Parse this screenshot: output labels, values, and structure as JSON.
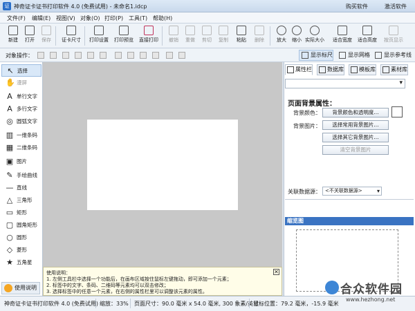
{
  "window": {
    "title": "神奇证卡证书打印软件 4.0 (免费试用) - 未命名1.idcp",
    "buy": "购买软件",
    "activate": "激活软件"
  },
  "menu": [
    "文件(F)",
    "编辑(E)",
    "视图(V)",
    "对象(O)",
    "打印(P)",
    "工具(T)",
    "帮助(H)"
  ],
  "toolbar": [
    {
      "label": "新建",
      "enabled": true
    },
    {
      "label": "打开",
      "enabled": true
    },
    {
      "label": "保存",
      "enabled": false
    },
    {
      "label": "证卡尺寸",
      "enabled": true
    },
    {
      "label": "打印设置",
      "enabled": true
    },
    {
      "label": "打印预览",
      "enabled": true
    },
    {
      "label": "直接打印",
      "enabled": true
    },
    {
      "label": "撤销",
      "enabled": false
    },
    {
      "label": "重做",
      "enabled": false
    },
    {
      "label": "剪切",
      "enabled": false
    },
    {
      "label": "复制",
      "enabled": false
    },
    {
      "label": "粘贴",
      "enabled": true
    },
    {
      "label": "删除",
      "enabled": false
    },
    {
      "label": "放大",
      "enabled": true
    },
    {
      "label": "缩小",
      "enabled": true
    },
    {
      "label": "实际大小",
      "enabled": true
    },
    {
      "label": "适合宽度",
      "enabled": true
    },
    {
      "label": "适合高度",
      "enabled": true
    },
    {
      "label": "按页显示",
      "enabled": false
    }
  ],
  "toolbar2": {
    "label": "对象操作：",
    "show_ruler": "显示标尺",
    "show_grid": "显示网格",
    "show_guides": "显示参考线"
  },
  "tools": [
    "选择",
    "漫屏",
    "单行文字",
    "多行文字",
    "圆弧文字",
    "一维条码",
    "二维条码",
    "图片",
    "手绘曲线",
    "直线",
    "三角形",
    "矩形",
    "圆角矩形",
    "圆形",
    "菱形",
    "五角星"
  ],
  "help_button": "使用说明",
  "info": {
    "title": "使用说明：",
    "lines": [
      "1. 左侧工具栏中选择一个功能后，在画布区域按住鼠标左键拖动，即可添加一个元素；",
      "2. 标签中的文字、条码、二维码等元素均可以双击修改；",
      "3. 选择标签中的任意一个元素，在右侧的属性栏里可以调整该元素的属性。"
    ],
    "close": "✕"
  },
  "right_tabs": [
    "属性栏",
    "数据库",
    "模板库",
    "素材库"
  ],
  "props": {
    "title": "页面背景属性：",
    "bg_color_label": "背景颜色：",
    "bg_color_btn": "背景颜色和透明度...",
    "bg_image_label": "背景图片：",
    "common_img_btn": "选择常用背景图片...",
    "other_img_btn": "选择其它背景图片...",
    "clear_img_btn": "清空背景图片",
    "bg_color": "#ffffff"
  },
  "datasource": {
    "label": "关联数据源：",
    "value": "<不关联数据源>"
  },
  "preview": {
    "title": "缩览图"
  },
  "status": {
    "app": "神奇证卡证书打印软件 4.0 (免费试用)",
    "zoom": "缩放：33%",
    "page": "页面尺寸：90.0 毫米 x 54.0 毫米, 300 象素/英寸",
    "mouse": "鼠标位置：79.2 毫米，-15.9 毫米"
  },
  "watermark": {
    "name": "合众软件园",
    "url": "www.hezhong.net"
  }
}
